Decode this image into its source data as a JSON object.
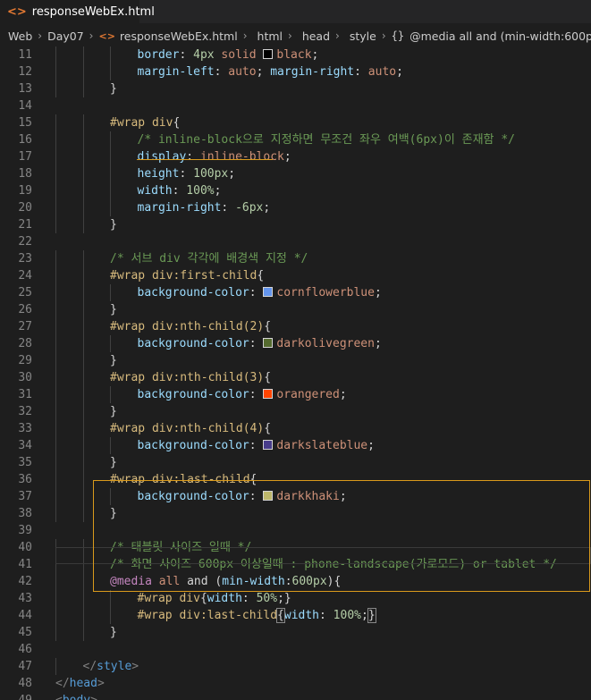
{
  "tab": {
    "label": "responseWebEx.html"
  },
  "breadcrumb": {
    "items": [
      "Web",
      "Day07",
      "responseWebEx.html",
      "html",
      "head",
      "style",
      "@media all and (min-width:600p"
    ]
  },
  "colors": {
    "cornflowerblue": "#6495ed",
    "darkolivegreen": "#556b2f",
    "orangered": "#ff4500",
    "darkslateblue": "#483d8b",
    "darkkhaki": "#bdb76b"
  },
  "editor": {
    "lines": [
      {
        "n": "11",
        "indent": 3,
        "parts": [
          [
            "prop",
            "border"
          ],
          [
            "plain",
            ": "
          ],
          [
            "num",
            "4px"
          ],
          [
            "val",
            " solid "
          ],
          [
            "swatch",
            "#000000"
          ],
          [
            "val",
            "black"
          ],
          [
            "plain",
            ";"
          ]
        ]
      },
      {
        "n": "12",
        "indent": 3,
        "parts": [
          [
            "prop",
            "margin-left"
          ],
          [
            "plain",
            ": "
          ],
          [
            "val",
            "auto"
          ],
          [
            "plain",
            "; "
          ],
          [
            "prop",
            "margin-right"
          ],
          [
            "plain",
            ": "
          ],
          [
            "val",
            "auto"
          ],
          [
            "plain",
            ";"
          ]
        ]
      },
      {
        "n": "13",
        "indent": 2,
        "parts": [
          [
            "plain",
            "}"
          ]
        ]
      },
      {
        "n": "14",
        "indent": 0,
        "parts": []
      },
      {
        "n": "15",
        "indent": 2,
        "parts": [
          [
            "sel",
            "#wrap div"
          ],
          [
            "plain",
            "{"
          ]
        ]
      },
      {
        "n": "16",
        "indent": 3,
        "parts": [
          [
            "com",
            "/* inline-block으로 지정하면 무조건 좌우 여백(6px)이 존재함 */"
          ]
        ]
      },
      {
        "n": "17",
        "indent": 3,
        "parts": [
          [
            "prop",
            "display"
          ],
          [
            "plain",
            ": "
          ],
          [
            "val",
            "inline-block"
          ],
          [
            "plain",
            ";"
          ]
        ]
      },
      {
        "n": "18",
        "indent": 3,
        "parts": [
          [
            "prop",
            "height"
          ],
          [
            "plain",
            ": "
          ],
          [
            "num",
            "100px"
          ],
          [
            "plain",
            ";"
          ]
        ]
      },
      {
        "n": "19",
        "indent": 3,
        "parts": [
          [
            "prop",
            "width"
          ],
          [
            "plain",
            ": "
          ],
          [
            "num",
            "100%"
          ],
          [
            "plain",
            ";"
          ]
        ]
      },
      {
        "n": "20",
        "indent": 3,
        "parts": [
          [
            "prop",
            "margin-right"
          ],
          [
            "plain",
            ": "
          ],
          [
            "num",
            "-6px"
          ],
          [
            "plain",
            ";"
          ]
        ]
      },
      {
        "n": "21",
        "indent": 2,
        "parts": [
          [
            "plain",
            "}"
          ]
        ]
      },
      {
        "n": "22",
        "indent": 0,
        "parts": []
      },
      {
        "n": "23",
        "indent": 2,
        "parts": [
          [
            "com",
            "/* 서브 div 각각에 배경색 지정 */"
          ]
        ]
      },
      {
        "n": "24",
        "indent": 2,
        "parts": [
          [
            "sel",
            "#wrap div:first-child"
          ],
          [
            "plain",
            "{"
          ]
        ]
      },
      {
        "n": "25",
        "indent": 3,
        "parts": [
          [
            "prop",
            "background-color"
          ],
          [
            "plain",
            ": "
          ],
          [
            "swatch",
            "#6495ed"
          ],
          [
            "val",
            "cornflowerblue"
          ],
          [
            "plain",
            ";"
          ]
        ]
      },
      {
        "n": "26",
        "indent": 2,
        "parts": [
          [
            "plain",
            "}"
          ]
        ]
      },
      {
        "n": "27",
        "indent": 2,
        "parts": [
          [
            "sel",
            "#wrap div:nth-child(2)"
          ],
          [
            "plain",
            "{"
          ]
        ]
      },
      {
        "n": "28",
        "indent": 3,
        "parts": [
          [
            "prop",
            "background-color"
          ],
          [
            "plain",
            ": "
          ],
          [
            "swatch",
            "#556b2f"
          ],
          [
            "val",
            "darkolivegreen"
          ],
          [
            "plain",
            ";"
          ]
        ]
      },
      {
        "n": "29",
        "indent": 2,
        "parts": [
          [
            "plain",
            "}"
          ]
        ]
      },
      {
        "n": "30",
        "indent": 2,
        "parts": [
          [
            "sel",
            "#wrap div:nth-child(3)"
          ],
          [
            "plain",
            "{"
          ]
        ]
      },
      {
        "n": "31",
        "indent": 3,
        "parts": [
          [
            "prop",
            "background-color"
          ],
          [
            "plain",
            ": "
          ],
          [
            "swatch",
            "#ff4500"
          ],
          [
            "val",
            "orangered"
          ],
          [
            "plain",
            ";"
          ]
        ]
      },
      {
        "n": "32",
        "indent": 2,
        "parts": [
          [
            "plain",
            "}"
          ]
        ]
      },
      {
        "n": "33",
        "indent": 2,
        "parts": [
          [
            "sel",
            "#wrap div:nth-child(4)"
          ],
          [
            "plain",
            "{"
          ]
        ]
      },
      {
        "n": "34",
        "indent": 3,
        "parts": [
          [
            "prop",
            "background-color"
          ],
          [
            "plain",
            ": "
          ],
          [
            "swatch",
            "#483d8b"
          ],
          [
            "val",
            "darkslateblue"
          ],
          [
            "plain",
            ";"
          ]
        ]
      },
      {
        "n": "35",
        "indent": 2,
        "parts": [
          [
            "plain",
            "}"
          ]
        ]
      },
      {
        "n": "36",
        "indent": 2,
        "parts": [
          [
            "sel",
            "#wrap div:last-child"
          ],
          [
            "plain",
            "{"
          ]
        ]
      },
      {
        "n": "37",
        "indent": 3,
        "parts": [
          [
            "prop",
            "background-color"
          ],
          [
            "plain",
            ": "
          ],
          [
            "swatch",
            "#bdb76b"
          ],
          [
            "val",
            "darkkhaki"
          ],
          [
            "plain",
            ";"
          ]
        ]
      },
      {
        "n": "38",
        "indent": 2,
        "parts": [
          [
            "plain",
            "}"
          ]
        ]
      },
      {
        "n": "39",
        "indent": 0,
        "parts": []
      },
      {
        "n": "40",
        "indent": 2,
        "parts": [
          [
            "com",
            "/* 태블릿 사이즈 일때 */"
          ]
        ]
      },
      {
        "n": "41",
        "indent": 2,
        "parts": [
          [
            "com",
            "/* 화면 사이즈 600px 이상일때 : phone-landscape(가로모드) or tablet */"
          ]
        ]
      },
      {
        "n": "42",
        "indent": 2,
        "parts": [
          [
            "at",
            "@media"
          ],
          [
            "val",
            " all "
          ],
          [
            "plain",
            "and ("
          ],
          [
            "prop",
            "min-width"
          ],
          [
            "plain",
            ":"
          ],
          [
            "num",
            "600px"
          ],
          [
            "plain",
            ")"
          ],
          [
            "plain",
            "{"
          ]
        ]
      },
      {
        "n": "43",
        "indent": 3,
        "parts": [
          [
            "sel",
            "#wrap div"
          ],
          [
            "plain",
            "{"
          ],
          [
            "prop",
            "width"
          ],
          [
            "plain",
            ": "
          ],
          [
            "num",
            "50%"
          ],
          [
            "plain",
            ";}"
          ]
        ]
      },
      {
        "n": "44",
        "indent": 3,
        "parts": [
          [
            "sel",
            "#wrap div:last-child"
          ],
          [
            "bracket",
            "{"
          ],
          [
            "prop",
            "width"
          ],
          [
            "plain",
            ": "
          ],
          [
            "num",
            "100%"
          ],
          [
            "plain",
            ";"
          ],
          [
            "bracket",
            "}"
          ]
        ]
      },
      {
        "n": "45",
        "indent": 2,
        "parts": [
          [
            "plain",
            "}"
          ]
        ]
      },
      {
        "n": "46",
        "indent": 0,
        "parts": []
      },
      {
        "n": "47",
        "indent": 1,
        "parts": [
          [
            "punc",
            "</"
          ],
          [
            "tag",
            "style"
          ],
          [
            "punc",
            ">"
          ]
        ]
      },
      {
        "n": "48",
        "indent": 0,
        "parts": [
          [
            "punc",
            "</"
          ],
          [
            "tag",
            "head"
          ],
          [
            "punc",
            ">"
          ]
        ]
      },
      {
        "n": "49",
        "indent": 0,
        "parts": [
          [
            "punc",
            "<"
          ],
          [
            "tag",
            "body"
          ],
          [
            "punc",
            ">"
          ]
        ]
      }
    ]
  }
}
